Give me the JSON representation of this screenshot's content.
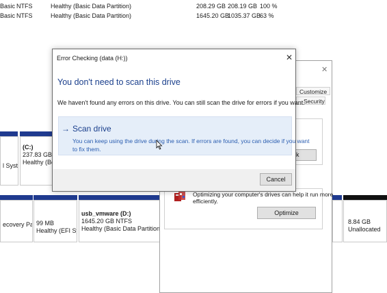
{
  "volumes": [
    {
      "type": "Basic",
      "fs": "NTFS",
      "status": "Healthy (Basic Data Partition)",
      "capacity": "208.29 GB",
      "free": "208.19 GB",
      "pct": "100 %"
    },
    {
      "type": "Basic",
      "fs": "NTFS",
      "status": "Healthy (Basic Data Partition)",
      "capacity": "1645.20 GB",
      "free": "1035.37 GB",
      "pct": "63 %"
    }
  ],
  "disk_map": {
    "disk0": {
      "p1": {
        "label": "l Syste"
      },
      "p2": {
        "title": "(C:)",
        "size": "237.83 GB NT",
        "status": "Healthy (Boo"
      }
    },
    "disk1": {
      "p1": {
        "label": "ecovery Partit"
      },
      "p2": {
        "size": "99 MB",
        "status": "Healthy (EFI Sys"
      },
      "p3": {
        "title": "usb_vmware  (D:)",
        "size": "1645.20 GB NTFS",
        "status": "Healthy (Basic Data Partition)"
      },
      "p4": {
        "size": "8.84 GB",
        "status": "Unallocated"
      }
    }
  },
  "bg_window": {
    "close": "✕",
    "tabs": {
      "customize": "Customize",
      "security": "Security"
    },
    "check_btn": "k",
    "optimize_text_1": "Optimizing your computer's drives can help it run more",
    "optimize_text_2": "efficiently.",
    "optimize_btn": "Optimize"
  },
  "dialog": {
    "title": "Error Checking (data (H:))",
    "close": "✕",
    "heading": "You don't need to scan this drive",
    "message": "We haven't found any errors on this drive. You can still scan the drive for errors if you want.",
    "scan_arrow": "→",
    "scan_title": "Scan drive",
    "scan_desc_1": "You can keep using the drive during the scan. If errors are found, you can decide if you want",
    "scan_desc_2": "to fix them.",
    "cancel": "Cancel"
  },
  "colors": {
    "accent": "#1a3f8c",
    "link": "#2a5db0",
    "stripe": "#1f3a8f",
    "unalloc": "#111111"
  }
}
